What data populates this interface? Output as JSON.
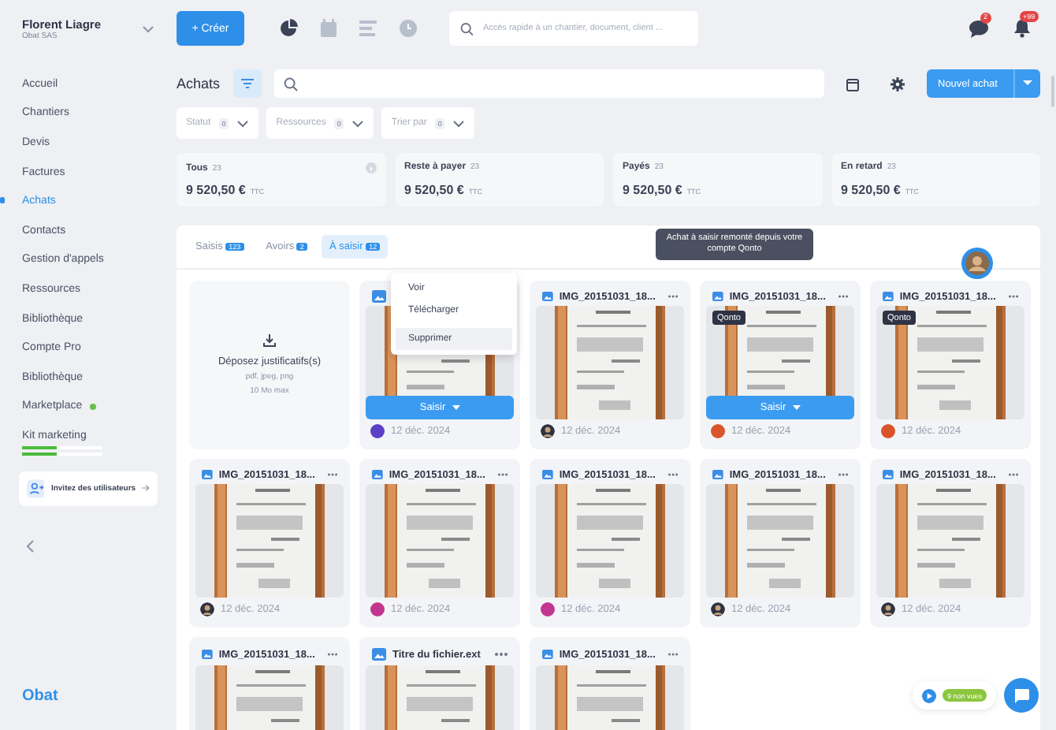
{
  "user": {
    "name": "Florent Liagre",
    "company": "Obat SAS"
  },
  "create_label": "+ Créer",
  "search": {
    "placeholder": "Accès rapide à un chantier, document, client ..."
  },
  "badges": {
    "messages": "2",
    "alerts": "+99"
  },
  "sidebar": {
    "items": [
      {
        "label": "Accueil",
        "selected": false
      },
      {
        "label": "Chantiers",
        "selected": false
      },
      {
        "label": "Devis",
        "selected": false
      },
      {
        "label": "Factures",
        "selected": false
      },
      {
        "label": "Achats",
        "selected": true
      },
      {
        "label": "Contacts",
        "selected": false
      },
      {
        "label": "Gestion d'appels",
        "selected": false
      },
      {
        "label": "Ressources",
        "selected": false
      },
      {
        "label": "Bibliothèque",
        "selected": false
      },
      {
        "label": "Compte Pro",
        "selected": false
      },
      {
        "label": "Bibliothèque",
        "selected": false
      },
      {
        "label": "Marketplace",
        "selected": false,
        "new": true
      },
      {
        "label": "Kit marketing",
        "selected": false,
        "progress": [
          {
            "level": 0.44
          },
          {
            "level": 0.44
          }
        ]
      }
    ],
    "invite": "Invitez des utilisateurs",
    "logo": "Obat"
  },
  "page": {
    "title": "Achats",
    "new_button": "Nouvel achat"
  },
  "filters": [
    {
      "label": "Statut",
      "count": "0"
    },
    {
      "label": "Ressources",
      "count": "0"
    },
    {
      "label": "Trier par",
      "count": "0"
    }
  ],
  "summary": [
    {
      "label": "Tous",
      "count": "23",
      "amount": "9 520,50 €",
      "unit": "TTC",
      "info": true
    },
    {
      "label": "Reste à payer",
      "count": "23",
      "amount": "9 520,50 €",
      "unit": "TTC",
      "info": false
    },
    {
      "label": "Payés",
      "count": "23",
      "amount": "9 520,50 €",
      "unit": "TTC",
      "info": false
    },
    {
      "label": "En retard",
      "count": "23",
      "amount": "9 520,50 €",
      "unit": "TTC",
      "info": false
    }
  ],
  "tabs": [
    {
      "label": "Saisis",
      "count": "123",
      "selected": false
    },
    {
      "label": "Avoirs",
      "count": "2",
      "selected": false
    },
    {
      "label": "À saisir",
      "count": "12",
      "selected": true
    }
  ],
  "dropzone": {
    "title": "Déposez justificatifs(s)",
    "formats": "pdf, jpeg, png",
    "max": "10 Mo max"
  },
  "cards": [
    {
      "date": "12 déc. 2024",
      "avatar": {
        "kind": "initials",
        "color": "#5b3fc4"
      },
      "action": "Saisir",
      "menu": [
        {
          "label": "Voir",
          "selected": false
        },
        {
          "label": "Télécharger",
          "selected": false
        },
        {
          "label": "Supprimer",
          "selected": true
        }
      ]
    },
    {
      "title": "IMG_20151031_18...",
      "date": "12 déc. 2024"
    },
    {
      "title": "IMG_20151031_18...",
      "date": "12 déc. 2024",
      "avatar": {
        "kind": "initials",
        "color": "#d9542b"
      },
      "tag": "Qonto",
      "action": "Saisir",
      "tooltip": "Achat à saisir remonté depuis votre compte Qonto"
    },
    {
      "title": "IMG_20151031_18...",
      "date": "12 déc. 2024",
      "avatar": {
        "kind": "initials",
        "color": "#d9542b"
      },
      "tag": "Qonto",
      "presence": true
    },
    {
      "title": "IMG_20151031_18...",
      "date": "12 déc. 2024"
    },
    {
      "title": "IMG_20151031_18...",
      "date": "12 déc. 2024",
      "avatar": {
        "kind": "initials",
        "color": "#c2368f"
      }
    },
    {
      "title": "IMG_20151031_18...",
      "date": "12 déc. 2024",
      "avatar": {
        "kind": "initials",
        "color": "#c2368f"
      }
    },
    {
      "title": "IMG_20151031_18...",
      "date": "12 déc. 2024"
    },
    {
      "title": "IMG_20151031_18...",
      "date": "12 déc. 2024"
    },
    {
      "title": "IMG_20151031_18..."
    },
    {
      "title": "Titre du fichier.ext"
    },
    {
      "title": "IMG_20151031_18..."
    }
  ],
  "widget": {
    "unseen": "9 non vues"
  }
}
